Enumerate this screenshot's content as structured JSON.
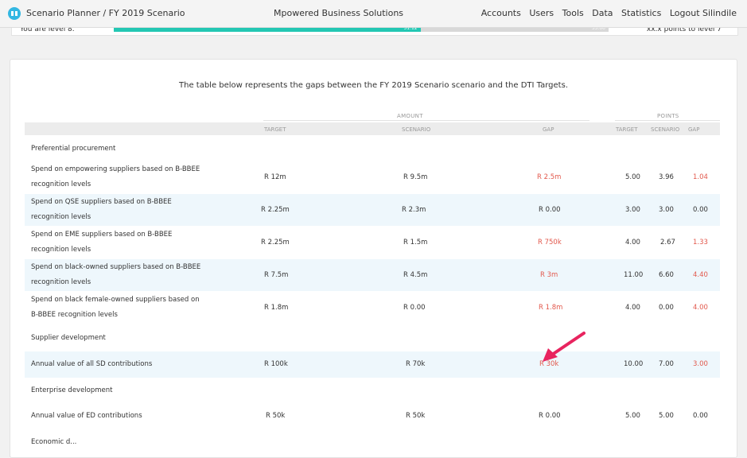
{
  "nav": {
    "breadcrumb": "Scenario Planner / FY 2019 Scenario",
    "company": "Mpowered Business Solutions",
    "links": [
      "Accounts",
      "Users",
      "Tools",
      "Data",
      "Statistics",
      "Logout Silindile"
    ]
  },
  "summary": {
    "left_label": "You are level 8.",
    "right_label": "xx.x points to level 7",
    "progress_value": "51.12",
    "progress_max": "55.00",
    "progress_fraction": 0.62
  },
  "intro": {
    "prefix": "The table below represents the gaps between the ",
    "scenario": "FY 2019 Scenario",
    "middle": " scenario and the ",
    "targets": "DTI Targets",
    "suffix": "."
  },
  "headers": {
    "amount": "AMOUNT",
    "points": "POINTS",
    "target": "TARGET",
    "scenario": "SCENARIO",
    "gap": "GAP",
    "p_target": "TARGET",
    "p_scenario": "SCENARIO",
    "p_gap": "GAP"
  },
  "sections": {
    "preferential": "Preferential procurement",
    "supplier_dev": "Supplier development",
    "enterprise_dev": "Enterprise development",
    "next": "Economic d..."
  },
  "rows": [
    {
      "label1": "Spend on empowering suppliers based on B-BBEE",
      "label2": "recognition levels",
      "target": "R 12m",
      "scenario": "R 9.5m",
      "gap": "R 2.5m",
      "p_target": "5.00",
      "p_scenario": "3.96",
      "p_gap": "1.04",
      "gap_red": true
    },
    {
      "label1": "Spend on QSE suppliers based on B-BBEE",
      "label2": "recognition levels",
      "target": "R 2.25m",
      "scenario": "R 2.3m",
      "gap": "R 0.00",
      "p_target": "3.00",
      "p_scenario": "3.00",
      "p_gap": "0.00",
      "gap_red": false
    },
    {
      "label1": "Spend on EME suppliers based on B-BBEE",
      "label2": "recognition levels",
      "target": "R 2.25m",
      "scenario": "R 1.5m",
      "gap": "R 750k",
      "p_target": "4.00",
      "p_scenario": "2.67",
      "p_gap": "1.33",
      "gap_red": true
    },
    {
      "label1": "Spend on black-owned suppliers based on B-BBEE",
      "label2": "recognition levels",
      "target": "R 7.5m",
      "scenario": "R 4.5m",
      "gap": "R 3m",
      "p_target": "11.00",
      "p_scenario": "6.60",
      "p_gap": "4.40",
      "gap_red": true
    },
    {
      "label1": "Spend on black female-owned suppliers based on",
      "label2": "B-BBEE recognition levels",
      "target": "R 1.8m",
      "scenario": "R 0.00",
      "gap": "R 1.8m",
      "p_target": "4.00",
      "p_scenario": "0.00",
      "p_gap": "4.00",
      "gap_red": true
    },
    {
      "label1": "Annual value of all SD contributions",
      "target": "R 100k",
      "scenario": "R 70k",
      "gap": "R 30k",
      "p_target": "10.00",
      "p_scenario": "7.00",
      "p_gap": "3.00",
      "gap_red": true
    },
    {
      "label1": "Annual value of ED contributions",
      "target": "R 50k",
      "scenario": "R 50k",
      "gap": "R 0.00",
      "p_target": "5.00",
      "p_scenario": "5.00",
      "p_gap": "0.00",
      "gap_red": false
    }
  ],
  "colors": {
    "accent_teal": "#23c7b3",
    "gap_red": "#e2584c",
    "arrow": "#e8245f",
    "row_shade": "#eef7fc"
  }
}
